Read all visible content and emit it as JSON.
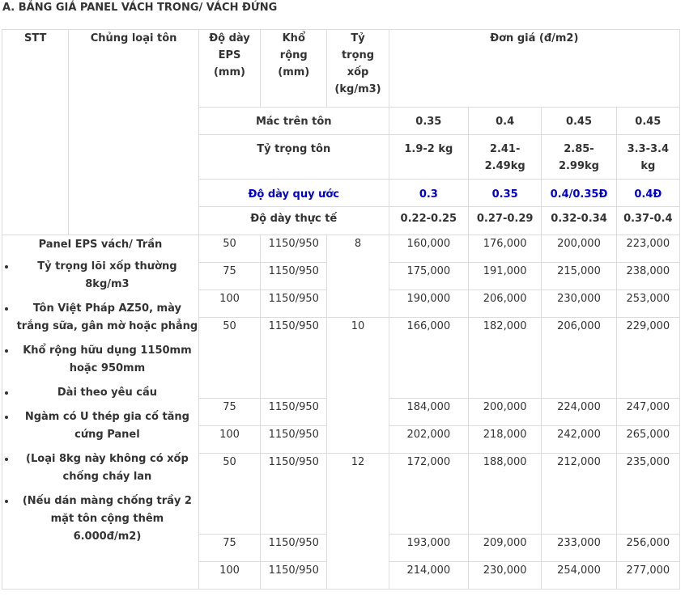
{
  "title": "A. BẢNG GIÁ PANEL VÁCH TRONG/ VÁCH ĐỨNG",
  "header": {
    "stt": "STT",
    "type": "Chủng loại tôn",
    "thickness": [
      "Độ dày",
      "EPS",
      "(mm)"
    ],
    "width": [
      "Khổ",
      "rộng",
      "(mm)"
    ],
    "density": [
      "Tỷ",
      "trọng",
      "xốp",
      "(kg/m3)"
    ],
    "price": "Đơn giá (đ/m2)"
  },
  "spec_rows": {
    "mac_label": "Mác trên tôn",
    "mac": [
      "0.35",
      "0.4",
      "0.45",
      "0.45"
    ],
    "tt_label": "Tỷ trọng tôn",
    "tt": [
      [
        "1.9-2 kg"
      ],
      [
        "2.41-",
        "2.49kg"
      ],
      [
        "2.85-",
        "2.99kg"
      ],
      [
        "3.3-3.4",
        "kg"
      ]
    ],
    "dq_label": "Độ dày quy ước",
    "dq": [
      "0.3",
      "0.35",
      "0.4/0.35Đ",
      "0.4Đ"
    ],
    "dt_label": "Độ dày thực tế",
    "dt": [
      "0.22-0.25",
      "0.27-0.29",
      "0.32-0.34",
      "0.37-0.4"
    ]
  },
  "product": {
    "title": "Panel EPS vách/ Trần",
    "bullets": [
      "Tỷ trọng lõi xốp thường 8kg/m3",
      "Tôn Việt Pháp AZ50, mày trắng sữa, gân mờ hoặc phẳng",
      "Khổ rộng hữu dụng 1150mm hoặc 950mm",
      "Dài theo yêu cầu",
      "Ngàm có U thép gia cố tăng cứng Panel",
      "(Loại 8kg này không có xốp chống cháy lan",
      "(Nếu dán màng chống trầy 2 mặt tôn cộng thêm 6.000đ/m2)"
    ]
  },
  "groups": [
    {
      "density": "8",
      "rows": [
        {
          "thickness": "50",
          "width": "1150/950",
          "prices": [
            "160,000",
            "176,000",
            "200,000",
            "223,000"
          ]
        },
        {
          "thickness": "75",
          "width": "1150/950",
          "prices": [
            "175,000",
            "191,000",
            "215,000",
            "238,000"
          ]
        },
        {
          "thickness": "100",
          "width": "1150/950",
          "prices": [
            "190,000",
            "206,000",
            "230,000",
            "253,000"
          ]
        }
      ]
    },
    {
      "density": "10",
      "rows": [
        {
          "thickness": "50",
          "width": "1150/950",
          "prices": [
            "166,000",
            "182,000",
            "206,000",
            "229,000"
          ]
        },
        {
          "thickness": "75",
          "width": "1150/950",
          "prices": [
            "184,000",
            "200,000",
            "224,000",
            "247,000"
          ]
        },
        {
          "thickness": "100",
          "width": "1150/950",
          "prices": [
            "202,000",
            "218,000",
            "242,000",
            "265,000"
          ]
        }
      ]
    },
    {
      "density": "12",
      "rows": [
        {
          "thickness": "50",
          "width": "1150/950",
          "prices": [
            "172,000",
            "188,000",
            "212,000",
            "235,000"
          ]
        },
        {
          "thickness": "75",
          "width": "1150/950",
          "prices": [
            "193,000",
            "209,000",
            "233,000",
            "256,000"
          ]
        },
        {
          "thickness": "100",
          "width": "1150/950",
          "prices": [
            "214,000",
            "230,000",
            "254,000",
            "277,000"
          ]
        }
      ]
    }
  ],
  "colors": {
    "blue_row": "#0000cc",
    "text": "#333333",
    "border": "#dcdcdc"
  }
}
